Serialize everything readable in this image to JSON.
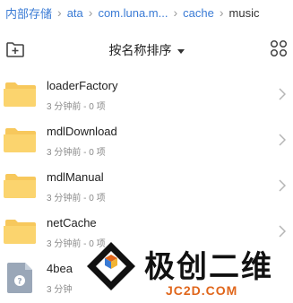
{
  "breadcrumb": [
    "内部存储",
    "ata",
    "com.luna.m...",
    "cache",
    "music"
  ],
  "sort_label": "按名称排序",
  "items": [
    {
      "name": "loaderFactory",
      "meta": "3 分钟前 - 0 项",
      "kind": "folder"
    },
    {
      "name": "mdlDownload",
      "meta": "3 分钟前 - 0 项",
      "kind": "folder"
    },
    {
      "name": "mdlManual",
      "meta": "3 分钟前 - 0 项",
      "kind": "folder"
    },
    {
      "name": "netCache",
      "meta": "3 分钟前 - 0 项",
      "kind": "folder"
    },
    {
      "name": "4bea",
      "meta": "3 分钟",
      "kind": "file"
    }
  ],
  "watermark": {
    "main": "极创二维",
    "sub": "JC2D.COM"
  },
  "colors": {
    "folder": "#f7c85c",
    "link": "#3a7bd5",
    "accent": "#e0661b"
  }
}
